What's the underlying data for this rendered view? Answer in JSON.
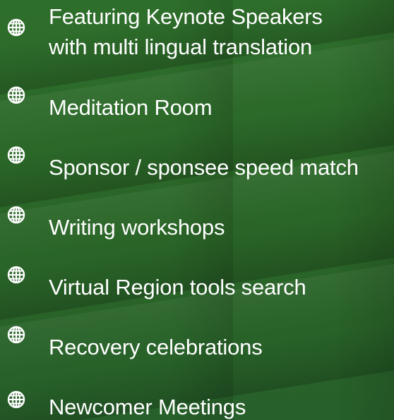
{
  "theme": {
    "background": "#2d6a2a",
    "text_color": "#ffffff",
    "bullet_color": "#ffffff"
  },
  "bullet_icon": "globe-icon",
  "items": [
    {
      "line1": "Featuring Keynote Speakers",
      "line2": "with multi lingual translation"
    },
    {
      "line1": "Meditation Room"
    },
    {
      "line1": "Sponsor / sponsee speed match"
    },
    {
      "line1": "Writing workshops"
    },
    {
      "line1": "Virtual Region tools search"
    },
    {
      "line1": "Recovery celebrations"
    },
    {
      "line1": "Newcomer Meetings"
    }
  ]
}
